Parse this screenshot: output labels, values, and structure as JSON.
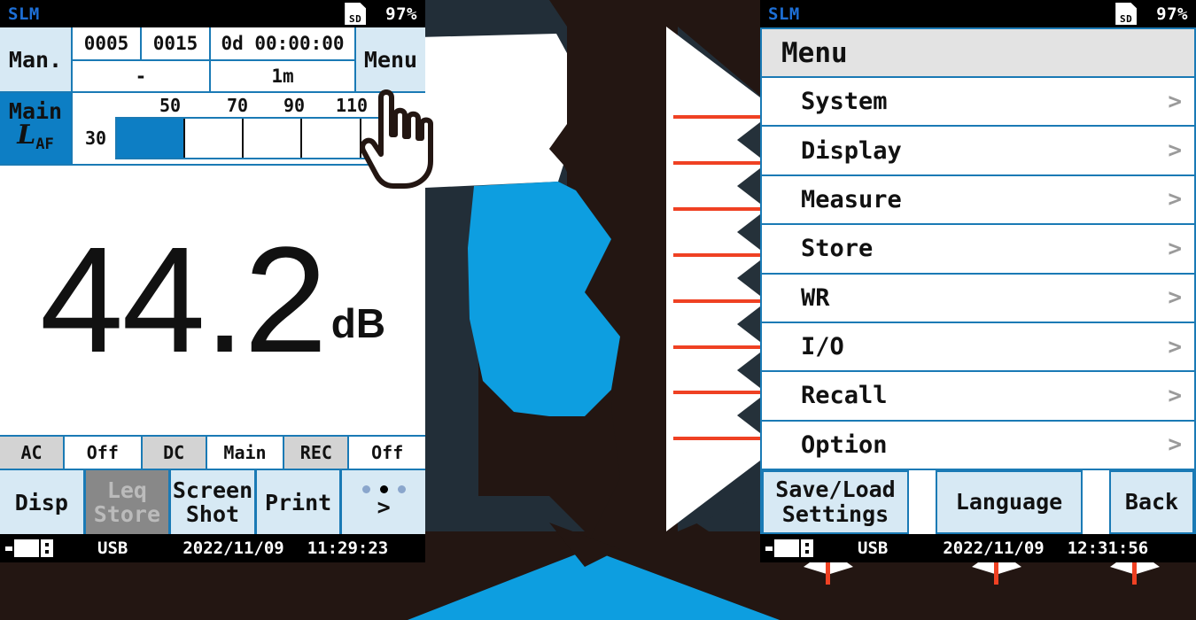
{
  "meta": {
    "accent_blue": "#0d7ec4",
    "border_blue": "#1a7ab5",
    "softkey_blue": "#d7e9f4",
    "callout_red": "#ef4123",
    "dark_bg": "#231612",
    "slate_bg": "#222e38"
  },
  "left_screen": {
    "status": {
      "title": "SLM",
      "sd_label": "SD",
      "battery": "97%"
    },
    "header": {
      "mode": "Man.",
      "store_no": "0005",
      "addr_no": "0015",
      "elapsed": "0d 00:00:00",
      "dash": "-",
      "interval": "1m",
      "menu": "Menu"
    },
    "level": {
      "channel": "Main",
      "weighting_l": "L",
      "weighting_sub": "AF",
      "scale_min": "30",
      "ticks": [
        "50",
        "70",
        "90",
        "110"
      ],
      "bar_percent": 22
    },
    "reading": {
      "value": "44.2",
      "unit": "dB"
    },
    "io_row": [
      {
        "label": "AC",
        "value": "Off"
      },
      {
        "label": "DC",
        "value": "Main"
      },
      {
        "label": "REC",
        "value": "Off"
      }
    ],
    "softkeys": [
      {
        "label": "Disp",
        "disabled": false
      },
      {
        "label_line1": "Leq",
        "label_line2": "Store",
        "disabled": true
      },
      {
        "label_line1": "Screen",
        "label_line2": "Shot",
        "disabled": false
      },
      {
        "label": "Print",
        "disabled": false
      },
      {
        "label": ">",
        "dots": 3,
        "active_dot": 1,
        "disabled": false
      }
    ],
    "footer": {
      "usb": "USB",
      "date": "2022/11/09",
      "time": "11:29:23"
    }
  },
  "right_screen": {
    "status": {
      "title": "SLM",
      "sd_label": "SD",
      "battery": "97%"
    },
    "title": "Menu",
    "items": [
      {
        "label": "System",
        "chevron": ">"
      },
      {
        "label": "Display",
        "chevron": ">"
      },
      {
        "label": "Measure",
        "chevron": ">"
      },
      {
        "label": "Store",
        "chevron": ">"
      },
      {
        "label": "WR",
        "chevron": ">"
      },
      {
        "label": "I/O",
        "chevron": ">"
      },
      {
        "label": "Recall",
        "chevron": ">"
      },
      {
        "label": "Option",
        "chevron": ">"
      }
    ],
    "softkeys": [
      {
        "line1": "Save/Load",
        "line2": "Settings"
      },
      {
        "line1": "Language",
        "line2": ""
      },
      {
        "line1": "Back",
        "line2": ""
      }
    ],
    "footer": {
      "usb": "USB",
      "date": "2022/11/09",
      "time": "12:31:56"
    }
  }
}
